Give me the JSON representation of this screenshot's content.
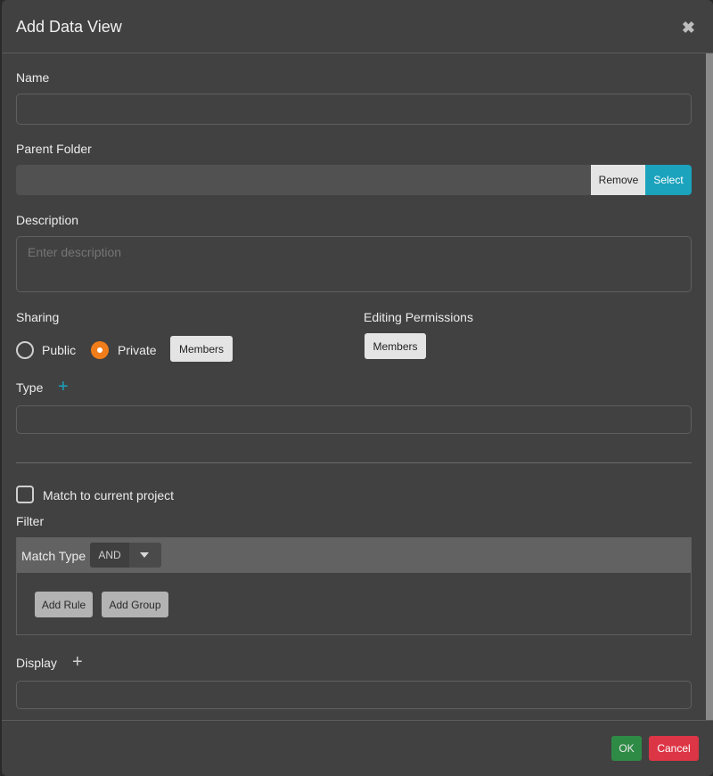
{
  "dialog": {
    "title": "Add Data View",
    "close_icon": "close-icon"
  },
  "name": {
    "label": "Name",
    "value": ""
  },
  "parent_folder": {
    "label": "Parent Folder",
    "value": "",
    "remove_label": "Remove",
    "select_label": "Select"
  },
  "description": {
    "label": "Description",
    "placeholder": "Enter description",
    "value": ""
  },
  "sharing": {
    "label": "Sharing",
    "options": [
      {
        "label": "Public",
        "selected": false
      },
      {
        "label": "Private",
        "selected": true
      }
    ],
    "members_label": "Members"
  },
  "editing_permissions": {
    "label": "Editing Permissions",
    "members_label": "Members"
  },
  "type": {
    "label": "Type",
    "value": ""
  },
  "match_project": {
    "label": "Match to current project",
    "checked": false
  },
  "filter": {
    "label": "Filter",
    "match_type_label": "Match Type",
    "match_type_value": "AND",
    "add_rule_label": "Add Rule",
    "add_group_label": "Add Group"
  },
  "display": {
    "label": "Display",
    "value": ""
  },
  "footer": {
    "ok_label": "OK",
    "cancel_label": "Cancel"
  },
  "colors": {
    "accent": "#1ba3bd",
    "radio_selected": "#f07d1a",
    "ok": "#2e8b46",
    "cancel": "#dc3545"
  }
}
